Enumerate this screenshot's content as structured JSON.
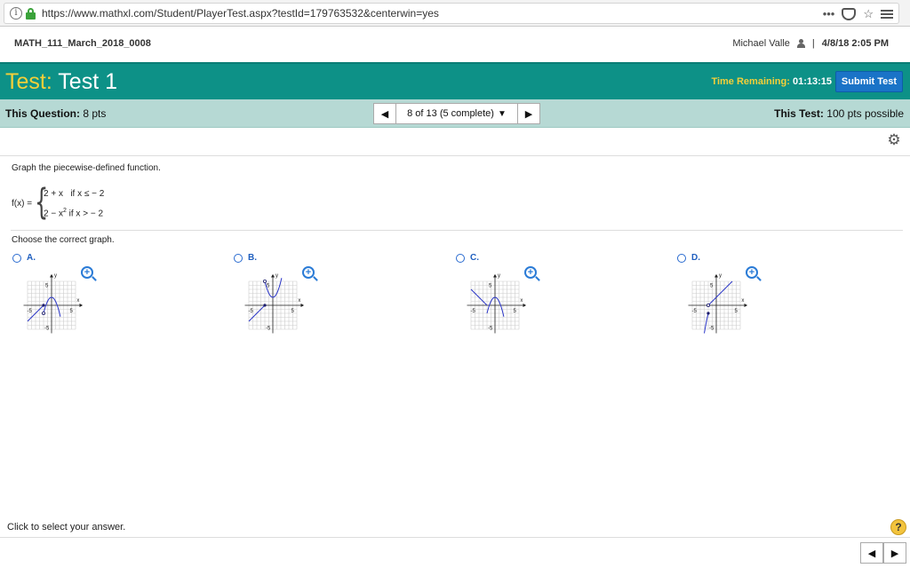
{
  "browser": {
    "url": "https://www.mathxl.com/Student/PlayerTest.aspx?testId=179763532&centerwin=yes",
    "more": "•••"
  },
  "header": {
    "course": "MATH_111_March_2018_0008",
    "user": "Michael Valle",
    "separator": "|",
    "datetime": "4/8/18 2:05 PM"
  },
  "testbar": {
    "label": "Test:",
    "name": "Test 1",
    "time_label": "Time Remaining:",
    "time_value": "01:13:15",
    "submit_label": "Submit Test"
  },
  "qbar": {
    "question_label": "This Question:",
    "question_pts": "8 pts",
    "nav_text": "8 of 13 (5 complete)",
    "test_label": "This Test:",
    "test_pts": "100 pts possible"
  },
  "question": {
    "prompt": "Graph the piecewise-defined function.",
    "lhs": "f(x) =",
    "row1_expr": "2 + x",
    "row1_cond": "if x ≤ − 2",
    "row2_expr": "2 − x",
    "row2_exp": "2",
    "row2_cond": "if x > − 2",
    "choose": "Choose the correct graph."
  },
  "options": [
    {
      "letter": "A."
    },
    {
      "letter": "B."
    },
    {
      "letter": "C."
    },
    {
      "letter": "D."
    }
  ],
  "graph_labels": {
    "y": "y",
    "x": "x",
    "pos": "5",
    "neg": "-5"
  },
  "footer": {
    "hint": "Click to select your answer.",
    "help": "?"
  },
  "colors": {
    "teal": "#0d9187",
    "gold": "#f5cf39",
    "submit": "#1a73c7",
    "curve": "#2a35c8"
  }
}
